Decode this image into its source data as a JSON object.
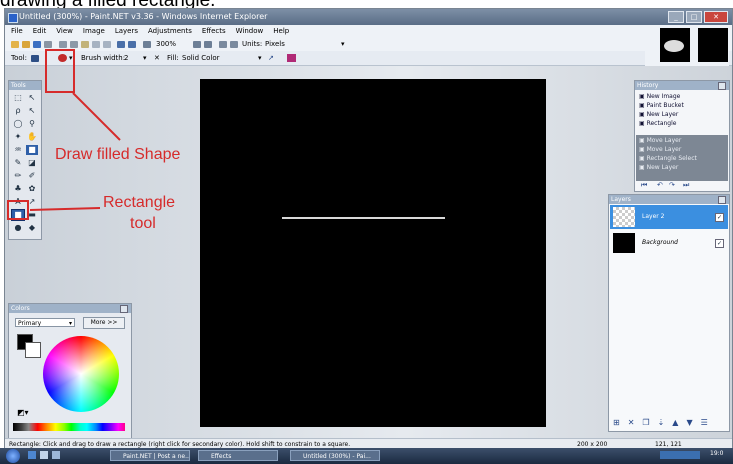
{
  "caption": "drawing a filled rectangle.",
  "window": {
    "title": "Untitled (300%) - Paint.NET v3.36 - Windows Internet Explorer"
  },
  "menubar": [
    "File",
    "Edit",
    "View",
    "Image",
    "Layers",
    "Adjustments",
    "Effects",
    "Window",
    "Help"
  ],
  "toolbar1": {
    "zoom": "300%",
    "units_label": "Units:",
    "units_value": "Pixels"
  },
  "toolbar2": {
    "tool_label": "Tool:",
    "brush_width_label": "Brush width:",
    "brush_width_value": "2",
    "fill_label": "Fill:",
    "fill_value": "Solid Color"
  },
  "tools_panel": {
    "title": "Tools"
  },
  "colors_panel": {
    "title": "Colors",
    "select_value": "Primary",
    "more_button": "More >>"
  },
  "history_panel": {
    "title": "History",
    "items": [
      {
        "label": "New Image",
        "active": true
      },
      {
        "label": "Paint Bucket",
        "active": true
      },
      {
        "label": "New Layer",
        "active": true
      },
      {
        "label": "Rectangle",
        "active": true
      },
      {
        "label": "Move Layer",
        "active": false
      },
      {
        "label": "Move Layer",
        "active": false
      },
      {
        "label": "Rectangle Select",
        "active": false
      },
      {
        "label": "New Layer",
        "active": false
      }
    ]
  },
  "layers_panel": {
    "title": "Layers",
    "layers": [
      {
        "name": "Layer 2",
        "selected": true
      },
      {
        "name": "Background",
        "selected": false
      }
    ]
  },
  "annotations": {
    "draw_filled_shape": "Draw filled Shape",
    "rectangle_tool_line1": "Rectangle",
    "rectangle_tool_line2": "tool",
    "color": "#d62b2b"
  },
  "statusbar": {
    "hint": "Rectangle: Click and drag to draw a rectangle (right click for secondary color). Hold shift to constrain to a square.",
    "image_size": "200 x 200",
    "cursor_pos": "121, 121"
  },
  "taskbar": {
    "items": [
      "Paint.NET | Post a ne...",
      "Effects",
      "Untitled (300%) - Pai..."
    ],
    "clock": "19:0"
  }
}
